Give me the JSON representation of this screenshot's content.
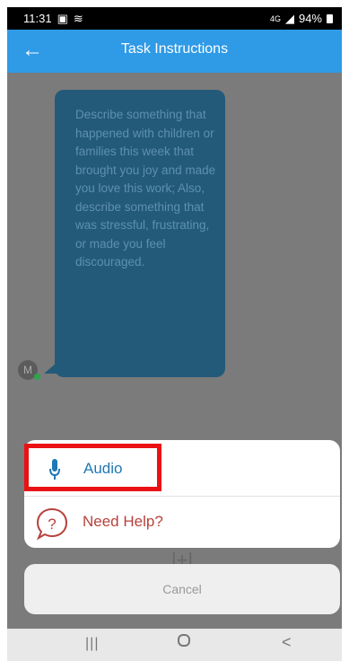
{
  "status_bar": {
    "time": "11:31",
    "signal_text": "4G",
    "battery": "94%"
  },
  "app_bar": {
    "title": "Task Instructions"
  },
  "message": {
    "text": "Describe something that happened with children or families this week that brought you joy and made you love this work; Also, describe something that was stressful, frustrating, or made you feel discouraged.",
    "avatar_initial": "M"
  },
  "sheet": {
    "audio_label": "Audio",
    "help_label": "Need Help?",
    "help_symbol": "?"
  },
  "cancel_label": "Cancel",
  "nav": {
    "recent": "|||",
    "back": "<"
  },
  "colors": {
    "app_bar": "#2f9ae6",
    "bubble": "#235a7a",
    "audio_text": "#1f78b6",
    "help_text": "#b7413c",
    "highlight": "#ea1115"
  }
}
